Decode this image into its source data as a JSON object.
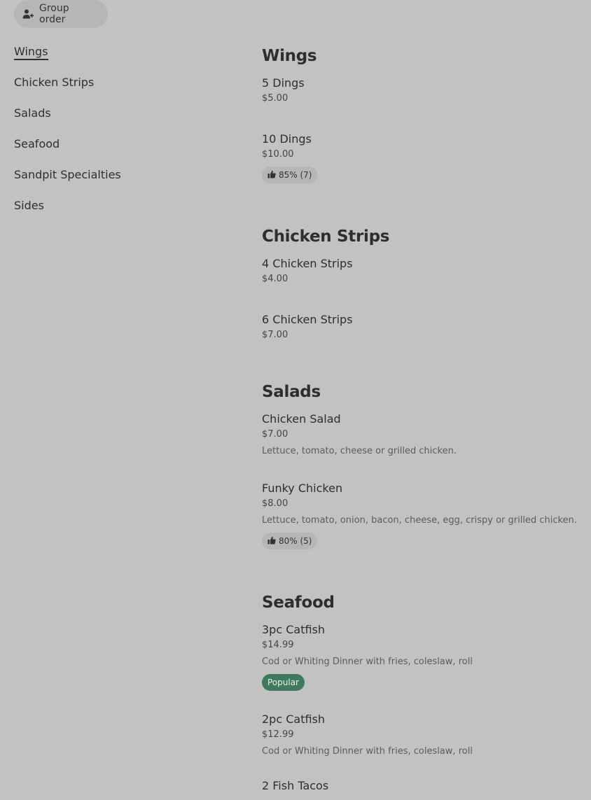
{
  "header": {
    "group_order_label": "Group order",
    "group_order_icon": "add-person-icon"
  },
  "nav": {
    "items": [
      {
        "label": "Wings",
        "active": true
      },
      {
        "label": "Chicken Strips",
        "active": false
      },
      {
        "label": "Salads",
        "active": false
      },
      {
        "label": "Seafood",
        "active": false
      },
      {
        "label": "Sandpit Specialties",
        "active": false
      },
      {
        "label": "Sides",
        "active": false
      }
    ]
  },
  "menu": {
    "sections": [
      {
        "title": "Wings",
        "items": [
          {
            "name": "5 Dings",
            "price": "$5.00"
          },
          {
            "name": "10 Dings",
            "price": "$10.00",
            "rating": "85% (7)"
          }
        ]
      },
      {
        "title": "Chicken Strips",
        "items": [
          {
            "name": "4 Chicken Strips",
            "price": "$4.00"
          },
          {
            "name": "6 Chicken Strips",
            "price": "$7.00"
          }
        ]
      },
      {
        "title": "Salads",
        "items": [
          {
            "name": "Chicken Salad",
            "price": "$7.00",
            "description": "Lettuce, tomato, cheese or grilled chicken."
          },
          {
            "name": "Funky Chicken",
            "price": "$8.00",
            "description": "Lettuce, tomato, onion, bacon, cheese, egg, crispy or grilled chicken.",
            "rating": "80% (5)"
          }
        ]
      },
      {
        "title": "Seafood",
        "items": [
          {
            "name": "3pc Catfish",
            "price": "$14.99",
            "description": "Cod or Whiting Dinner with fries, coleslaw, roll",
            "badge": "Popular"
          },
          {
            "name": "2pc Catfish",
            "price": "$12.99",
            "description": "Cod or Whiting Dinner with fries, coleslaw, roll"
          },
          {
            "name": "2 Fish Tacos"
          }
        ]
      }
    ]
  },
  "colors": {
    "page_background": "#c2c2c2",
    "popular_badge": "#3f7a5c"
  }
}
